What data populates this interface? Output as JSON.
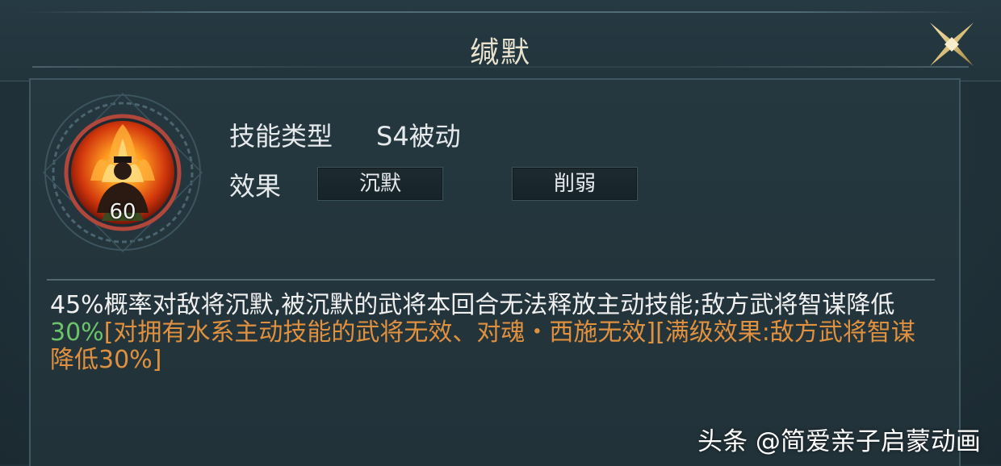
{
  "header": {
    "title": "缄默"
  },
  "skill": {
    "level": "60",
    "type_label": "技能类型",
    "type_value": "S4被动",
    "effect_label": "效果",
    "effects": [
      "沉默",
      "削弱"
    ]
  },
  "description": {
    "part1": "45%概率对敌将沉默,被沉默的武将本回合无法释放主动技能;敌方武将智谋降低",
    "part2_value": "30%",
    "part3": "[对拥有水系主动技能的武将无效、对魂・西施无效][满级效果:敌方武将智谋降低30%]"
  },
  "watermark": {
    "text": "头条 @简爱亲子启蒙动画"
  },
  "colors": {
    "background": "#203139",
    "title": "#e9e2cf",
    "value_green": "#6cc46a",
    "note_orange": "#e0913f",
    "close_gold": "#d9bf7a"
  },
  "icons": {
    "close": "close-x-icon",
    "skill": "meditating-figure-fire-icon"
  }
}
